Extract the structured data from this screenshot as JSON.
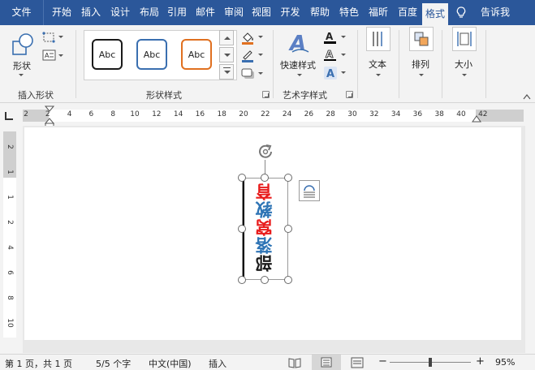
{
  "tabs": [
    {
      "label": "文件"
    },
    {
      "label": "开始"
    },
    {
      "label": "插入"
    },
    {
      "label": "设计"
    },
    {
      "label": "布局"
    },
    {
      "label": "引用"
    },
    {
      "label": "邮件"
    },
    {
      "label": "审阅"
    },
    {
      "label": "视图"
    },
    {
      "label": "开发"
    },
    {
      "label": "帮助"
    },
    {
      "label": "特色"
    },
    {
      "label": "福昕"
    },
    {
      "label": "百度"
    },
    {
      "label": "格式"
    }
  ],
  "tell_me": "告诉我",
  "ribbon": {
    "insert_shapes": {
      "shape_label": "形状",
      "group_label": "插入形状"
    },
    "shape_styles": {
      "samples": [
        "Abc",
        "Abc",
        "Abc"
      ],
      "group_label": "形状样式"
    },
    "wordart": {
      "quick_styles_label": "快速样式",
      "group_label": "艺术字样式"
    },
    "text_label": "文本",
    "arrange_label": "排列",
    "size_label": "大小"
  },
  "ruler": {
    "numbers": [
      "2",
      "2",
      "4",
      "6",
      "8",
      "10",
      "12",
      "14",
      "16",
      "18",
      "20",
      "22",
      "24",
      "26",
      "28",
      "30",
      "32",
      "34",
      "36",
      "38",
      "40",
      "42"
    ]
  },
  "vruler": {
    "numbers": [
      "2",
      "1",
      "1",
      "2",
      "4",
      "6",
      "8",
      "10"
    ]
  },
  "textbox": {
    "chars": [
      {
        "ch": "部",
        "color": "#1a1a1a"
      },
      {
        "ch": "落",
        "color": "#2e74b5"
      },
      {
        "ch": "窝",
        "color": "#e81c1c"
      },
      {
        "ch": "教",
        "color": "#2e74b5"
      },
      {
        "ch": "育",
        "color": "#e81c1c"
      }
    ]
  },
  "status": {
    "page": "第 1 页，共 1 页",
    "words": "5/5 个字",
    "language": "中文(中国)",
    "mode": "插入",
    "zoom": "95%",
    "zoom_minus": "−",
    "zoom_plus": "+",
    "zoom_level": 0.5
  },
  "colors": {
    "accent": "#2b579a",
    "shape_outline_swatch": "#e07020",
    "font_color_swatch": "#000000"
  }
}
